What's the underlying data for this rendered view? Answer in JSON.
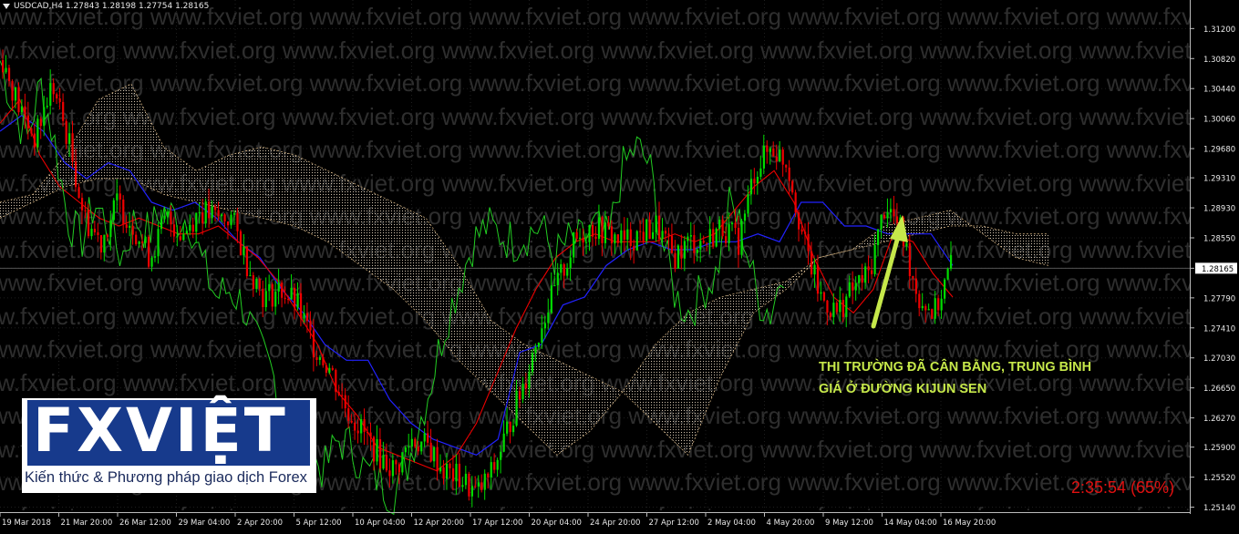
{
  "header": {
    "symbol": "USDCAD,H4",
    "ohlc": "1.27843 1.28198 1.27754 1.28165"
  },
  "watermark": {
    "text": "www.fxviet.org"
  },
  "logo": {
    "brand": "FXVIỆT",
    "tagline": "Kiến thức & Phương pháp giao dịch Forex"
  },
  "annotation": {
    "line1": "THỊ TRƯỜNG ĐÃ CÂN BẰNG, TRUNG BÌNH",
    "line2": "GIÁ Ở ĐƯỜNG KIJUN SEN"
  },
  "timer": {
    "text": "2:35:54 (65%)"
  },
  "colors": {
    "bull": "#00dd00",
    "bear": "#ee0000",
    "tenkan": "#ee0000",
    "kijun": "#2222ff",
    "chikou": "#22cc22",
    "cloud": "#e8d8c0",
    "annotation": "#c6e84a",
    "price_label_bg": "#ffffff",
    "timer": "#e01010",
    "arrow": "#c6e84a"
  },
  "chart_data": {
    "type": "candlestick",
    "symbol": "USDCAD",
    "timeframe": "H4",
    "current_price": 1.28165,
    "ylim": [
      1.251,
      1.314
    ],
    "y_ticks": [
      "1.31200",
      "1.30820",
      "1.30440",
      "1.30060",
      "1.29680",
      "1.29310",
      "1.28930",
      "1.28550",
      "1.28165",
      "1.27790",
      "1.27410",
      "1.27030",
      "1.26650",
      "1.26270",
      "1.25900",
      "1.25520",
      "1.25140"
    ],
    "x_ticks": [
      "19 Mar 2018",
      "21 Mar 20:00",
      "26 Mar 12:00",
      "29 Mar 04:00",
      "2 Apr 20:00",
      "5 Apr 12:00",
      "10 Apr 04:00",
      "12 Apr 20:00",
      "17 Apr 12:00",
      "20 Apr 04:00",
      "24 Apr 20:00",
      "27 Apr 12:00",
      "2 May 04:00",
      "4 May 20:00",
      "9 May 12:00",
      "14 May 04:00",
      "16 May 20:00"
    ],
    "grid": true,
    "indicators": [
      "Ichimoku Kinko Hyo: Tenkan-sen (red)",
      "Kijun-sen (blue)",
      "Chikou Span (green)",
      "Kumo cloud (dotted)"
    ],
    "close_path": [
      1.308,
      1.302,
      1.298,
      1.305,
      1.298,
      1.288,
      1.285,
      1.29,
      1.287,
      1.283,
      1.288,
      1.286,
      1.289,
      1.288,
      1.288,
      1.282,
      1.278,
      1.279,
      1.277,
      1.272,
      1.269,
      1.264,
      1.261,
      1.258,
      1.256,
      1.26,
      1.259,
      1.256,
      1.255,
      1.253,
      1.256,
      1.262,
      1.268,
      1.275,
      1.28,
      1.285,
      1.287,
      1.286,
      1.285,
      1.286,
      1.287,
      1.283,
      1.285,
      1.285,
      1.287,
      1.285,
      1.294,
      1.297,
      1.295,
      1.285,
      1.278,
      1.276,
      1.279,
      1.281,
      1.29,
      1.286,
      1.278,
      1.276,
      1.282
    ],
    "tenkan_path": [
      1.3,
      1.303,
      1.296,
      1.292,
      1.29,
      1.288,
      1.287,
      1.288,
      1.287,
      1.286,
      1.286,
      1.287,
      1.285,
      1.283,
      1.28,
      1.276,
      1.272,
      1.266,
      1.263,
      1.259,
      1.258,
      1.257,
      1.256,
      1.258,
      1.262,
      1.268,
      1.274,
      1.279,
      1.283,
      1.285,
      1.286,
      1.285,
      1.285,
      1.285,
      1.286,
      1.285,
      1.286,
      1.289,
      1.292,
      1.294,
      1.29,
      1.283,
      1.278,
      1.276,
      1.279,
      1.286,
      1.285,
      1.281,
      1.278
    ],
    "kijun_path": [
      1.299,
      1.301,
      1.299,
      1.295,
      1.293,
      1.295,
      1.294,
      1.29,
      1.289,
      1.29,
      1.288,
      1.285,
      1.283,
      1.279,
      1.276,
      1.272,
      1.27,
      1.27,
      1.265,
      1.262,
      1.26,
      1.259,
      1.258,
      1.26,
      1.271,
      1.272,
      1.277,
      1.278,
      1.282,
      1.284,
      1.285,
      1.284,
      1.284,
      1.285,
      1.285,
      1.286,
      1.285,
      1.29,
      1.29,
      1.287,
      1.287,
      1.286,
      1.286,
      1.286,
      1.282
    ]
  }
}
